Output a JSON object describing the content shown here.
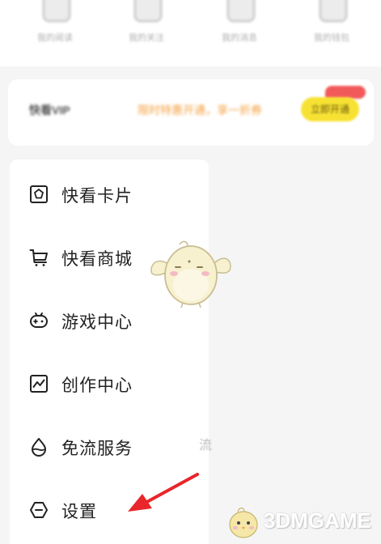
{
  "shortcuts": [
    {
      "label": "我的阅读",
      "icon": "clock-icon"
    },
    {
      "label": "我的关注",
      "icon": "bookmark-icon"
    },
    {
      "label": "我的消息",
      "icon": "message-icon"
    },
    {
      "label": "我的钱包",
      "icon": "wallet-icon"
    }
  ],
  "vip": {
    "title": "快看VIP",
    "promo": "限时特惠开通，享一折券",
    "button_label": "立即开通"
  },
  "menu": {
    "items": [
      {
        "label": "快看卡片",
        "icon": "card-pentagon-icon"
      },
      {
        "label": "快看商城",
        "icon": "shopping-cart-icon"
      },
      {
        "label": "游戏中心",
        "icon": "gamepad-icon"
      },
      {
        "label": "创作中心",
        "icon": "chart-line-icon"
      },
      {
        "label": "免流服务",
        "icon": "water-drop-icon"
      },
      {
        "label": "设置",
        "icon": "settings-hexagon-icon"
      }
    ]
  },
  "side_glyph": "流",
  "watermark": {
    "text": "3DMGAME"
  },
  "colors": {
    "accent_red": "#e8262b",
    "vip_yellow": "#f7e233",
    "promo_orange": "#f5a142",
    "panel_bg": "#ffffff",
    "page_bg": "#f5f5f5"
  }
}
